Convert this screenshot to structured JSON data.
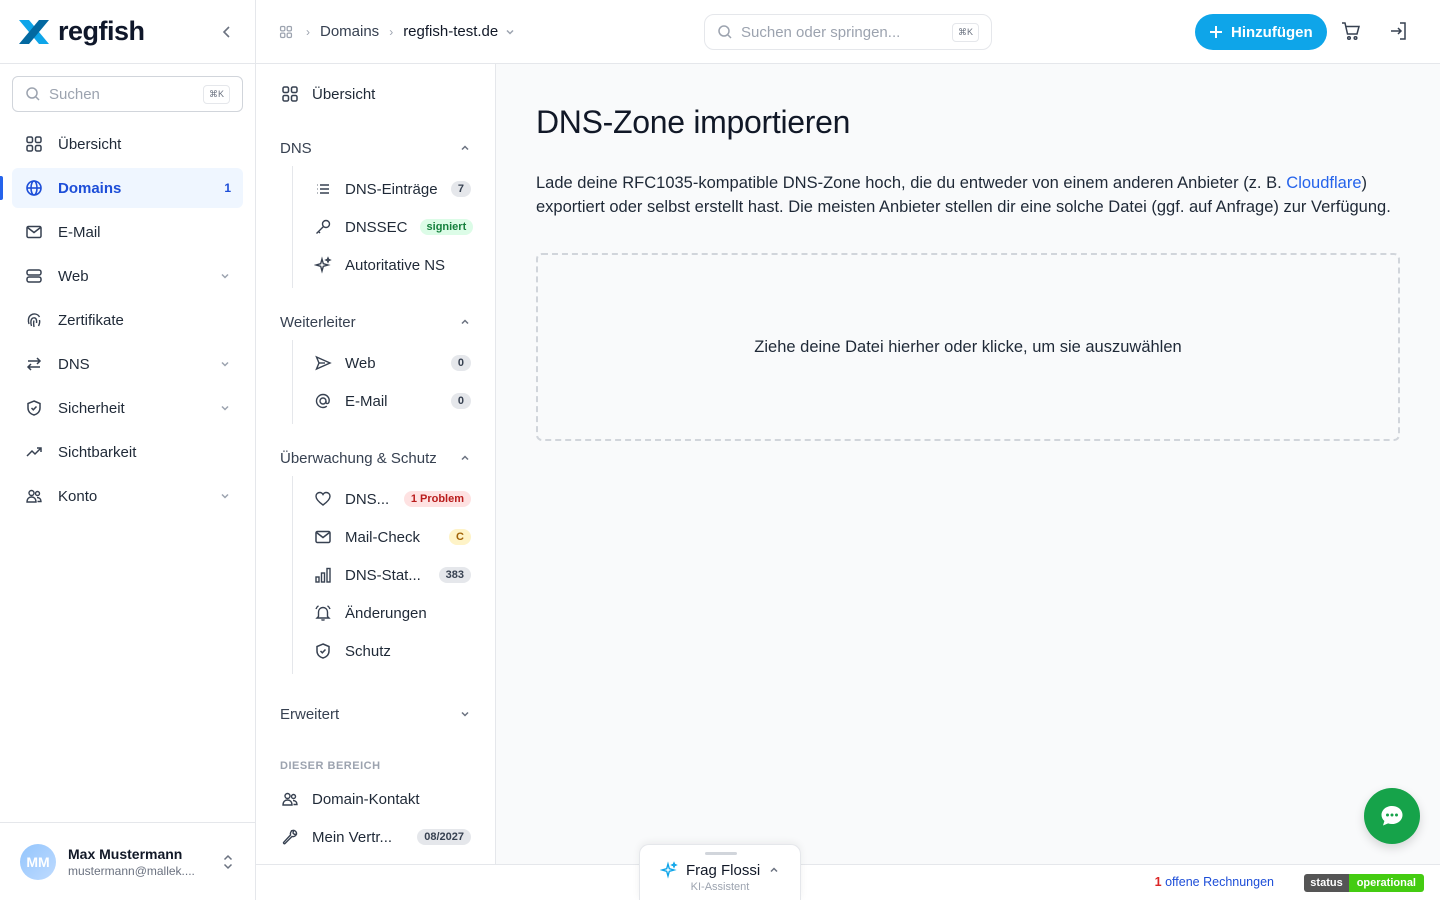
{
  "brand": {
    "name": "regfish",
    "logo_icon": "regfish-x-logo",
    "accent": "#0ea5e9"
  },
  "sidebar": {
    "search_placeholder": "Suchen",
    "search_shortcut": "⌘K",
    "items": [
      {
        "label": "Übersicht",
        "icon": "grid-icon"
      },
      {
        "label": "Domains",
        "icon": "globe-icon",
        "count": "1",
        "active": true
      },
      {
        "label": "E-Mail",
        "icon": "mail-icon"
      },
      {
        "label": "Web",
        "icon": "server-icon",
        "expandable": true
      },
      {
        "label": "Zertifikate",
        "icon": "fingerprint-icon"
      },
      {
        "label": "DNS",
        "icon": "arrows-icon",
        "expandable": true
      },
      {
        "label": "Sicherheit",
        "icon": "shield-icon",
        "expandable": true
      },
      {
        "label": "Sichtbarkeit",
        "icon": "trend-icon"
      },
      {
        "label": "Konto",
        "icon": "users-icon",
        "expandable": true
      }
    ],
    "user": {
      "initials": "MM",
      "name": "Max Mustermann",
      "email": "mustermann@mallek...."
    }
  },
  "topbar": {
    "breadcrumb": [
      "Domains",
      "regfish-test.de"
    ],
    "search_placeholder": "Suchen oder springen...",
    "search_shortcut": "⌘K",
    "add_label": "Hinzufügen"
  },
  "subnav": {
    "overview": "Übersicht",
    "groups": [
      {
        "title": "DNS",
        "items": [
          {
            "label": "DNS-Einträge",
            "badge": "7",
            "badge_style": "gray",
            "icon": "list-icon"
          },
          {
            "label": "DNSSEC",
            "badge": "signiert",
            "badge_style": "green",
            "icon": "key-icon"
          },
          {
            "label": "Autoritative NS",
            "badge": "",
            "icon": "sparkle-icon"
          }
        ]
      },
      {
        "title": "Weiterleiter",
        "items": [
          {
            "label": "Web",
            "badge": "0",
            "badge_style": "gray",
            "icon": "send-icon"
          },
          {
            "label": "E-Mail",
            "badge": "0",
            "badge_style": "gray",
            "icon": "at-icon"
          }
        ]
      },
      {
        "title": "Überwachung & Schutz",
        "items": [
          {
            "label": "DNS...",
            "badge": "1 Problem",
            "badge_style": "red",
            "icon": "heart-icon"
          },
          {
            "label": "Mail-Check",
            "badge": "C",
            "badge_style": "yellow",
            "icon": "mail-icon"
          },
          {
            "label": "DNS-Stat...",
            "badge": "383",
            "badge_style": "gray",
            "icon": "chart-icon"
          },
          {
            "label": "Änderungen",
            "badge": "",
            "icon": "bell-icon"
          },
          {
            "label": "Schutz",
            "badge": "",
            "icon": "shield-icon"
          }
        ]
      }
    ],
    "advanced": "Erweitert",
    "section_label": "DIESER BEREICH",
    "area_items": [
      {
        "label": "Domain-Kontakt",
        "badge": "",
        "icon": "users-icon"
      },
      {
        "label": "Mein Vertr...",
        "badge": "08/2027",
        "icon": "wrench-icon"
      }
    ]
  },
  "main": {
    "title": "DNS-Zone importieren",
    "desc_before": "Lade deine RFC1035-kompatible DNS-Zone hoch, die du entweder von einem anderen Anbieter (z. B. ",
    "desc_link": "Cloudflare",
    "desc_after": ") exportiert oder selbst erstellt hast. Die meisten Anbieter stellen dir eine solche Datei (ggf. auf Anfrage) zur Verfügung.",
    "dropzone": "Ziehe deine Datei hierher oder klicke, um sie auszuwählen"
  },
  "footer": {
    "invoices_count": "1",
    "invoices_label": " offene Rechnungen",
    "status_key": "status",
    "status_value": "operational"
  },
  "assistant": {
    "name": "Frag Flossi",
    "subtitle": "KI-Assistent"
  }
}
